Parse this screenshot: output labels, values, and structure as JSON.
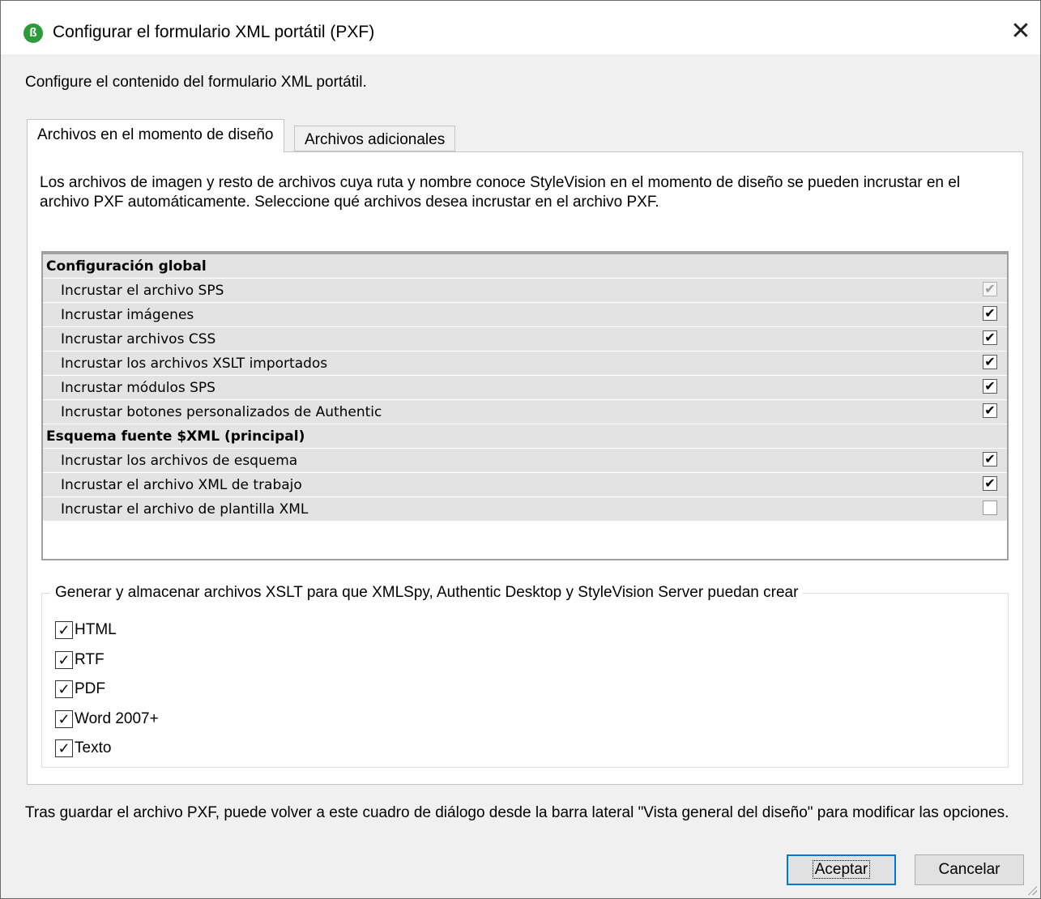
{
  "window": {
    "title": "Configurar el formulario XML portátil (PXF)",
    "app_icon_glyph": "ß",
    "close_glyph": "✕"
  },
  "intro": "Configure el contenido del formulario XML portátil.",
  "tabs": [
    {
      "label": "Archivos en el momento de diseño",
      "active": true
    },
    {
      "label": "Archivos adicionales",
      "active": false
    }
  ],
  "description": "Los archivos de imagen y resto de archivos cuya ruta y nombre conoce StyleVision en el momento de diseño se pueden incrustar en el archivo PXF automáticamente. Seleccione qué archivos desea incrustar en el archivo PXF.",
  "grid": {
    "groups": [
      {
        "title": "Configuración global",
        "items": [
          {
            "label": "Incrustar el archivo SPS",
            "checked": true,
            "disabled": true
          },
          {
            "label": "Incrustar imágenes",
            "checked": true,
            "disabled": false
          },
          {
            "label": "Incrustar archivos CSS",
            "checked": true,
            "disabled": false
          },
          {
            "label": "Incrustar los archivos XSLT importados",
            "checked": true,
            "disabled": false
          },
          {
            "label": "Incrustar módulos SPS",
            "checked": true,
            "disabled": false
          },
          {
            "label": "Incrustar botones personalizados de Authentic",
            "checked": true,
            "disabled": false
          }
        ]
      },
      {
        "title": "Esquema fuente $XML (principal)",
        "items": [
          {
            "label": "Incrustar los archivos de esquema",
            "checked": true,
            "disabled": false
          },
          {
            "label": "Incrustar el archivo XML de trabajo",
            "checked": true,
            "disabled": false
          },
          {
            "label": "Incrustar el archivo de plantilla XML",
            "checked": false,
            "disabled": false
          }
        ]
      }
    ]
  },
  "xslt_group": {
    "legend": "Generar y almacenar archivos XSLT para que XMLSpy, Authentic Desktop y StyleVision Server puedan crear",
    "options": [
      {
        "label": "HTML",
        "checked": true
      },
      {
        "label": "RTF",
        "checked": true
      },
      {
        "label": "PDF",
        "checked": true
      },
      {
        "label": "Word 2007+",
        "checked": true
      },
      {
        "label": "Texto",
        "checked": true
      }
    ]
  },
  "footer": "Tras guardar el archivo PXF, puede volver a este cuadro de diálogo desde la barra lateral \"Vista general del diseño\" para modificar las opciones.",
  "buttons": {
    "ok": "Aceptar",
    "cancel": "Cancelar"
  },
  "check_glyph": "✔",
  "light_check_glyph": "✓"
}
